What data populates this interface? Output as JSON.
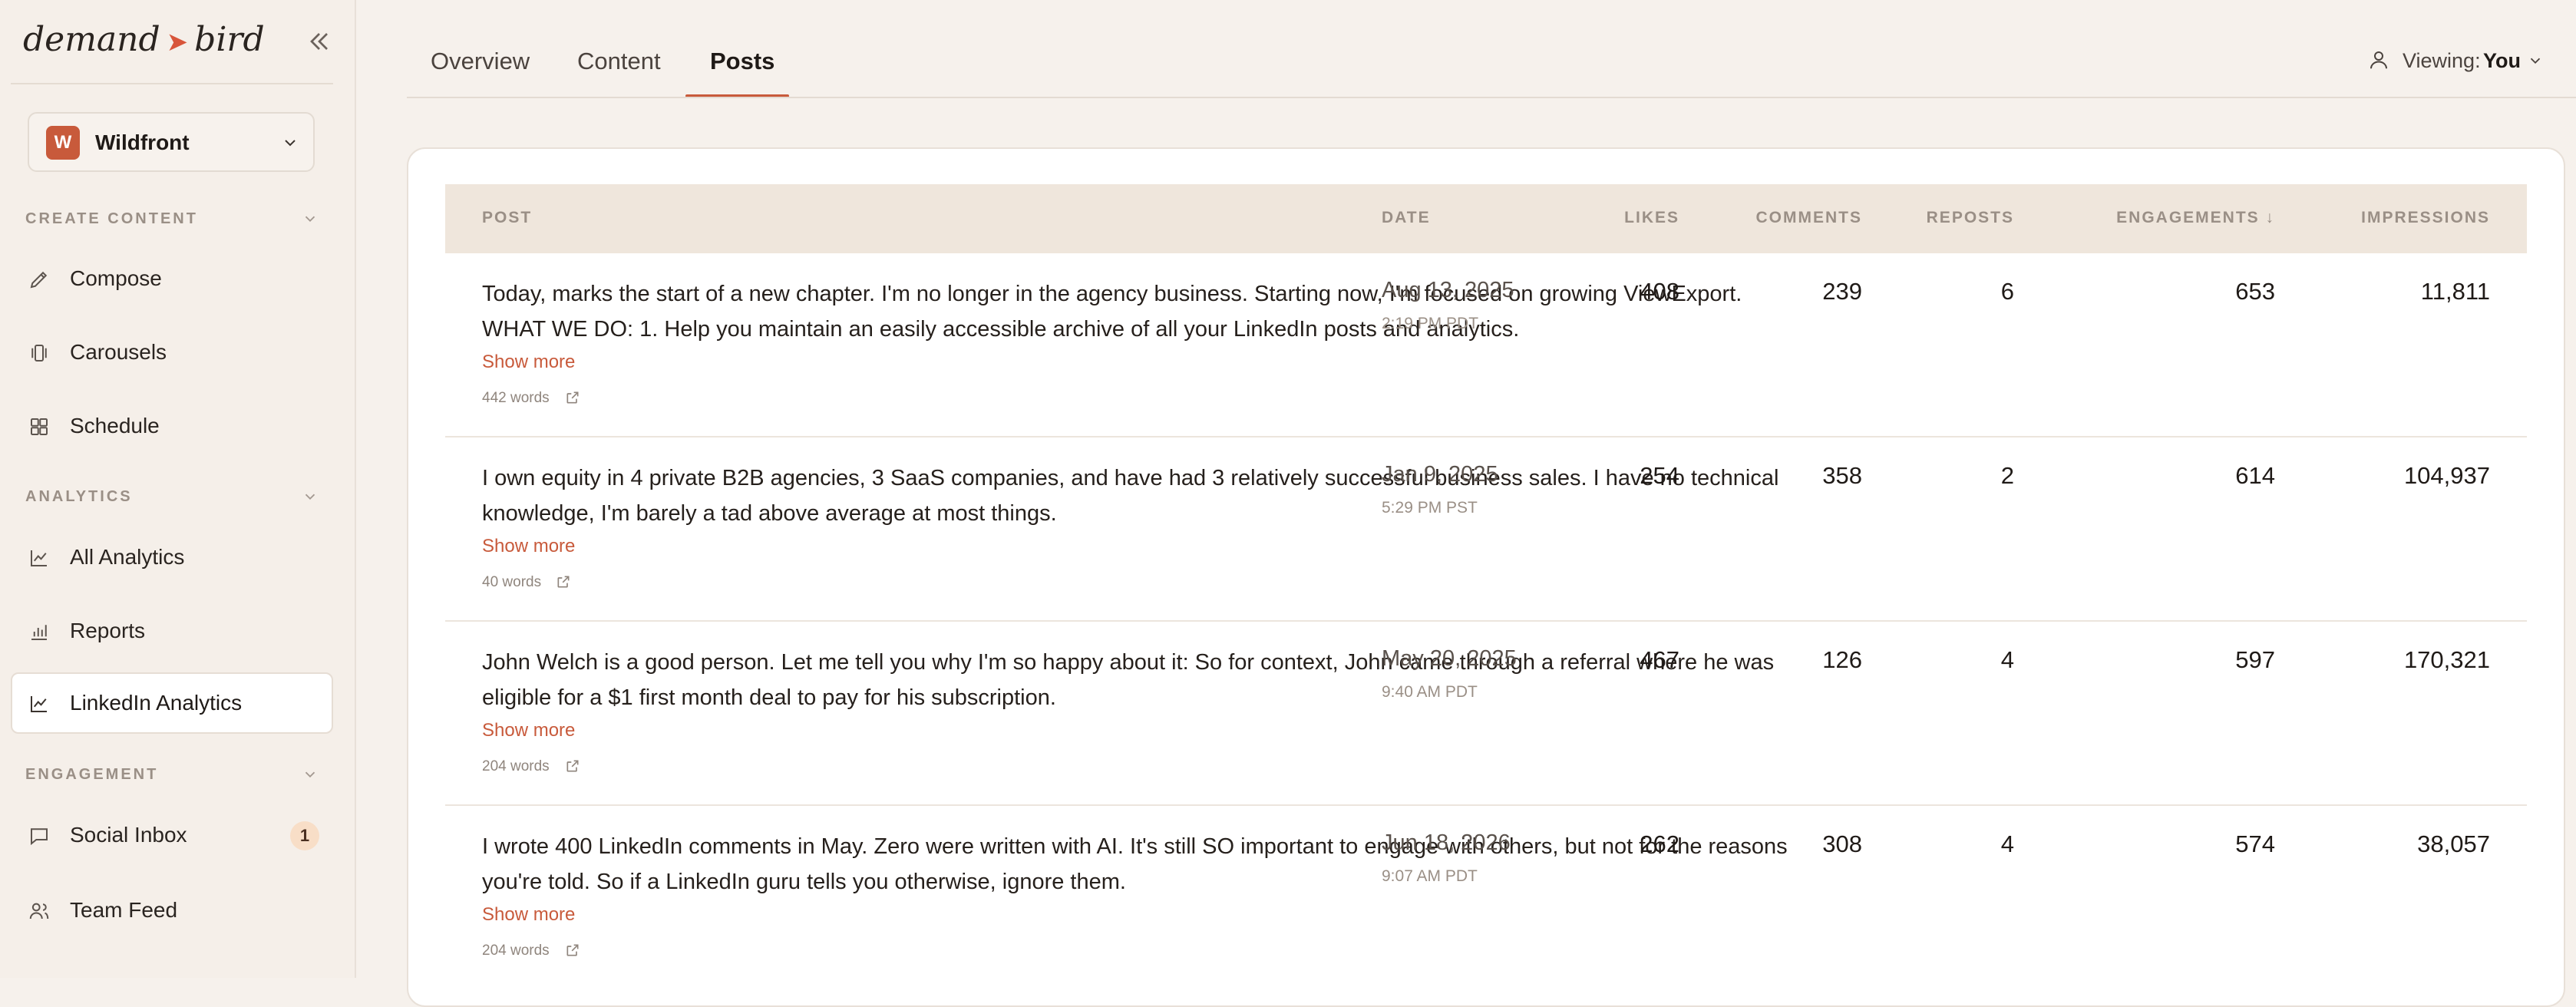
{
  "sidebar": {
    "logo_left": "demand",
    "logo_arrow": "➤",
    "logo_right": "bird",
    "workspace": {
      "initial": "W",
      "name": "Wildfront"
    },
    "sections": [
      {
        "title": "CREATE CONTENT",
        "items": [
          {
            "label": "Compose",
            "icon": "pencil-icon"
          },
          {
            "label": "Carousels",
            "icon": "carousel-icon"
          },
          {
            "label": "Schedule",
            "icon": "grid-icon"
          }
        ]
      },
      {
        "title": "ANALYTICS",
        "items": [
          {
            "label": "All Analytics",
            "icon": "line-chart-icon"
          },
          {
            "label": "Reports",
            "icon": "bar-chart-icon"
          },
          {
            "label": "LinkedIn Analytics",
            "icon": "line-chart-icon",
            "active": true
          }
        ]
      },
      {
        "title": "ENGAGEMENT",
        "items": [
          {
            "label": "Social Inbox",
            "icon": "chat-icon",
            "badge": "1"
          },
          {
            "label": "Team Feed",
            "icon": "users-icon"
          }
        ]
      }
    ]
  },
  "tabs": [
    "Overview",
    "Content",
    "Posts"
  ],
  "active_tab": "Posts",
  "viewing": {
    "label": "Viewing:",
    "value": "You"
  },
  "table": {
    "columns": [
      "POST",
      "DATE",
      "LIKES",
      "COMMENTS",
      "REPOSTS",
      "ENGAGEMENTS ↓",
      "IMPRESSIONS"
    ],
    "show_more_label": "Show more",
    "rows": [
      {
        "text": "Today, marks the start of a new chapter. I'm no longer in the agency business. Starting now, I'm focused on growing ViewExport. WHAT WE DO: 1. Help you maintain an easily accessible archive of all your LinkedIn posts and analytics.",
        "words": "442 words",
        "date": "Aug 13, 2025",
        "time": "2:19 PM PDT",
        "likes": "408",
        "comments": "239",
        "reposts": "6",
        "engagements": "653",
        "impressions": "11,811"
      },
      {
        "text": "I own equity in 4 private B2B agencies, 3 SaaS companies, and have had 3 relatively successful business sales. I have no technical knowledge, I'm barely a tad above average at most things.",
        "words": "40 words",
        "date": "Jan 9, 2025",
        "time": "5:29 PM PST",
        "likes": "254",
        "comments": "358",
        "reposts": "2",
        "engagements": "614",
        "impressions": "104,937"
      },
      {
        "text": "John Welch is a good person. Let me tell you why I'm so happy about it: So for context, John came through a referral where he was eligible for a $1 first month deal to pay for his subscription.",
        "words": "204 words",
        "date": "May 20, 2025",
        "time": "9:40 AM PDT",
        "likes": "467",
        "comments": "126",
        "reposts": "4",
        "engagements": "597",
        "impressions": "170,321"
      },
      {
        "text": "I wrote 400 LinkedIn comments in May. Zero were written with AI. It's still SO important to engage with others, but not for the reasons you're told. So if a LinkedIn guru tells you otherwise, ignore them.",
        "words": "204 words",
        "date": "Jun 18, 2026",
        "time": "9:07 AM PDT",
        "likes": "262",
        "comments": "308",
        "reposts": "4",
        "engagements": "574",
        "impressions": "38,057"
      }
    ]
  }
}
